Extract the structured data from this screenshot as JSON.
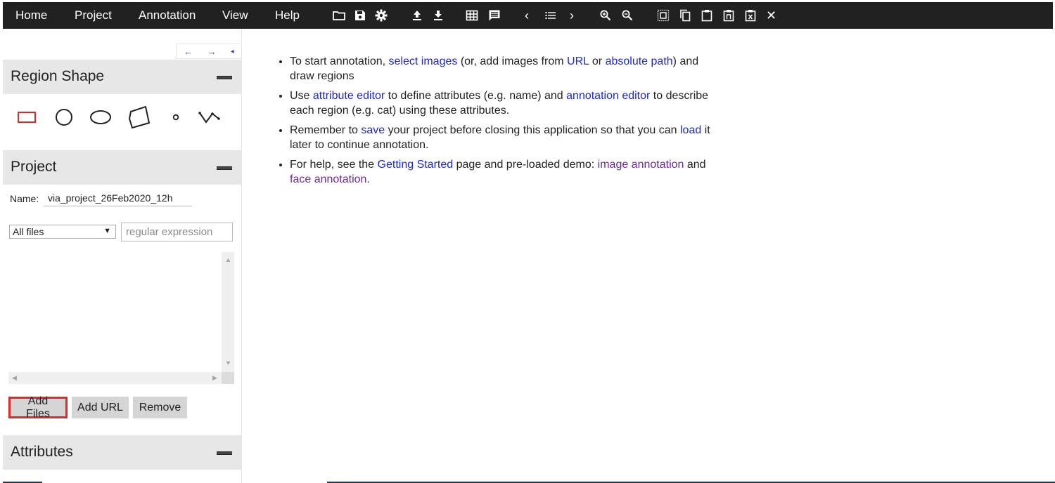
{
  "menu": {
    "items": [
      {
        "id": "home",
        "label": "Home"
      },
      {
        "id": "project",
        "label": "Project"
      },
      {
        "id": "annotation",
        "label": "Annotation"
      },
      {
        "id": "view",
        "label": "View"
      },
      {
        "id": "help",
        "label": "Help"
      }
    ],
    "toolbar_icons": [
      "folder-open-icon",
      "save-icon",
      "settings-icon",
      "upload-icon",
      "download-icon",
      "grid-view-icon",
      "comment-icon",
      "prev-image-icon",
      "image-list-icon",
      "next-image-icon",
      "zoom-in-icon",
      "zoom-out-icon",
      "select-all-regions-icon",
      "copy-region-icon",
      "paste-region-icon",
      "paste-n-region-icon",
      "delete-region-icon",
      "close-icon"
    ],
    "close_glyph": "✕",
    "prev_glyph": "‹",
    "next_glyph": "›"
  },
  "left_panel": {
    "nav_arrows": {
      "left": "←",
      "right": "→",
      "collapse": "◂"
    },
    "region_shape": {
      "title": "Region Shape",
      "shapes": [
        "rectangle",
        "circle",
        "ellipse",
        "polygon",
        "point",
        "polyline"
      ],
      "active": "rectangle",
      "active_color": "#e02828"
    },
    "project": {
      "title": "Project",
      "name_label": "Name:",
      "name_value": "via_project_26Feb2020_12h",
      "filter_selected": "All files",
      "filter_caret": "▼",
      "regex_placeholder": "regular expression",
      "buttons": {
        "add_files": "Add Files",
        "add_url": "Add URL",
        "remove": "Remove"
      }
    },
    "attributes": {
      "title": "Attributes"
    }
  },
  "main": {
    "items": [
      {
        "t1": "To start annotation,",
        "l1": "select images",
        "t2": "(or, add images from",
        "l2": "URL",
        "t3": "or",
        "l3": "absolute path",
        "t4": ")",
        "t5": "and draw regions"
      },
      {
        "t1": "Use",
        "l1": "attribute editor",
        "t2": "to define attributes (e.g. name) and",
        "l2": "annotation editor",
        "t3": "to",
        "t4": "describe each region (e.g. cat) using these attributes."
      },
      {
        "t1": "Remember to",
        "l1": "save",
        "t2": "your project before closing this application so that you can",
        "l2": "load",
        "t3": "it later to continue annotation."
      },
      {
        "t1": "For help, see the",
        "l1": "Getting Started",
        "t2": "page and pre-loaded demo:",
        "l2": "image annotation",
        "t3": "and",
        "l3": "face annotation",
        "t4": "."
      }
    ]
  },
  "colors": {
    "topbar": "#212121",
    "link": "#1d27d6",
    "visited_link": "#6a2a9a",
    "highlight": "#e02828"
  }
}
